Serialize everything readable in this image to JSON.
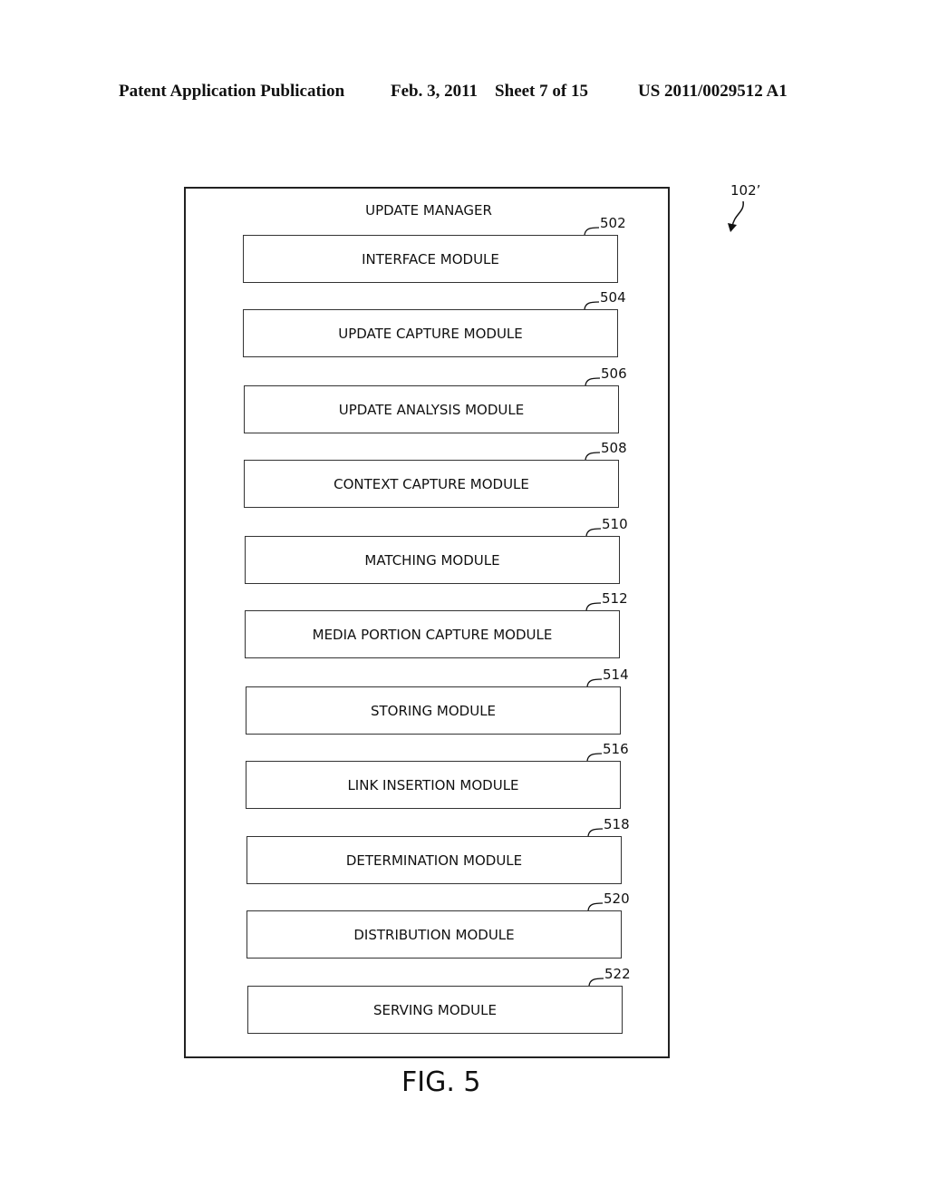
{
  "header": {
    "left": "Patent Application Publication",
    "date_sheet": "Feb. 3, 2011    Sheet 7 of 15",
    "number": "US 2011/0029512 A1"
  },
  "diagram": {
    "reference": "102’",
    "container_title": "UPDATE MANAGER",
    "modules": [
      {
        "label": "INTERFACE MODULE",
        "ref": "502"
      },
      {
        "label": "UPDATE CAPTURE MODULE",
        "ref": "504"
      },
      {
        "label": "UPDATE ANALYSIS MODULE",
        "ref": "506"
      },
      {
        "label": "CONTEXT CAPTURE MODULE",
        "ref": "508"
      },
      {
        "label": "MATCHING MODULE",
        "ref": "510"
      },
      {
        "label": "MEDIA PORTION CAPTURE MODULE",
        "ref": "512"
      },
      {
        "label": "STORING MODULE",
        "ref": "514"
      },
      {
        "label": "LINK INSERTION MODULE",
        "ref": "516"
      },
      {
        "label": "DETERMINATION MODULE",
        "ref": "518"
      },
      {
        "label": "DISTRIBUTION MODULE",
        "ref": "520"
      },
      {
        "label": "SERVING MODULE",
        "ref": "522"
      }
    ],
    "figure_label": "FIG. 5"
  }
}
